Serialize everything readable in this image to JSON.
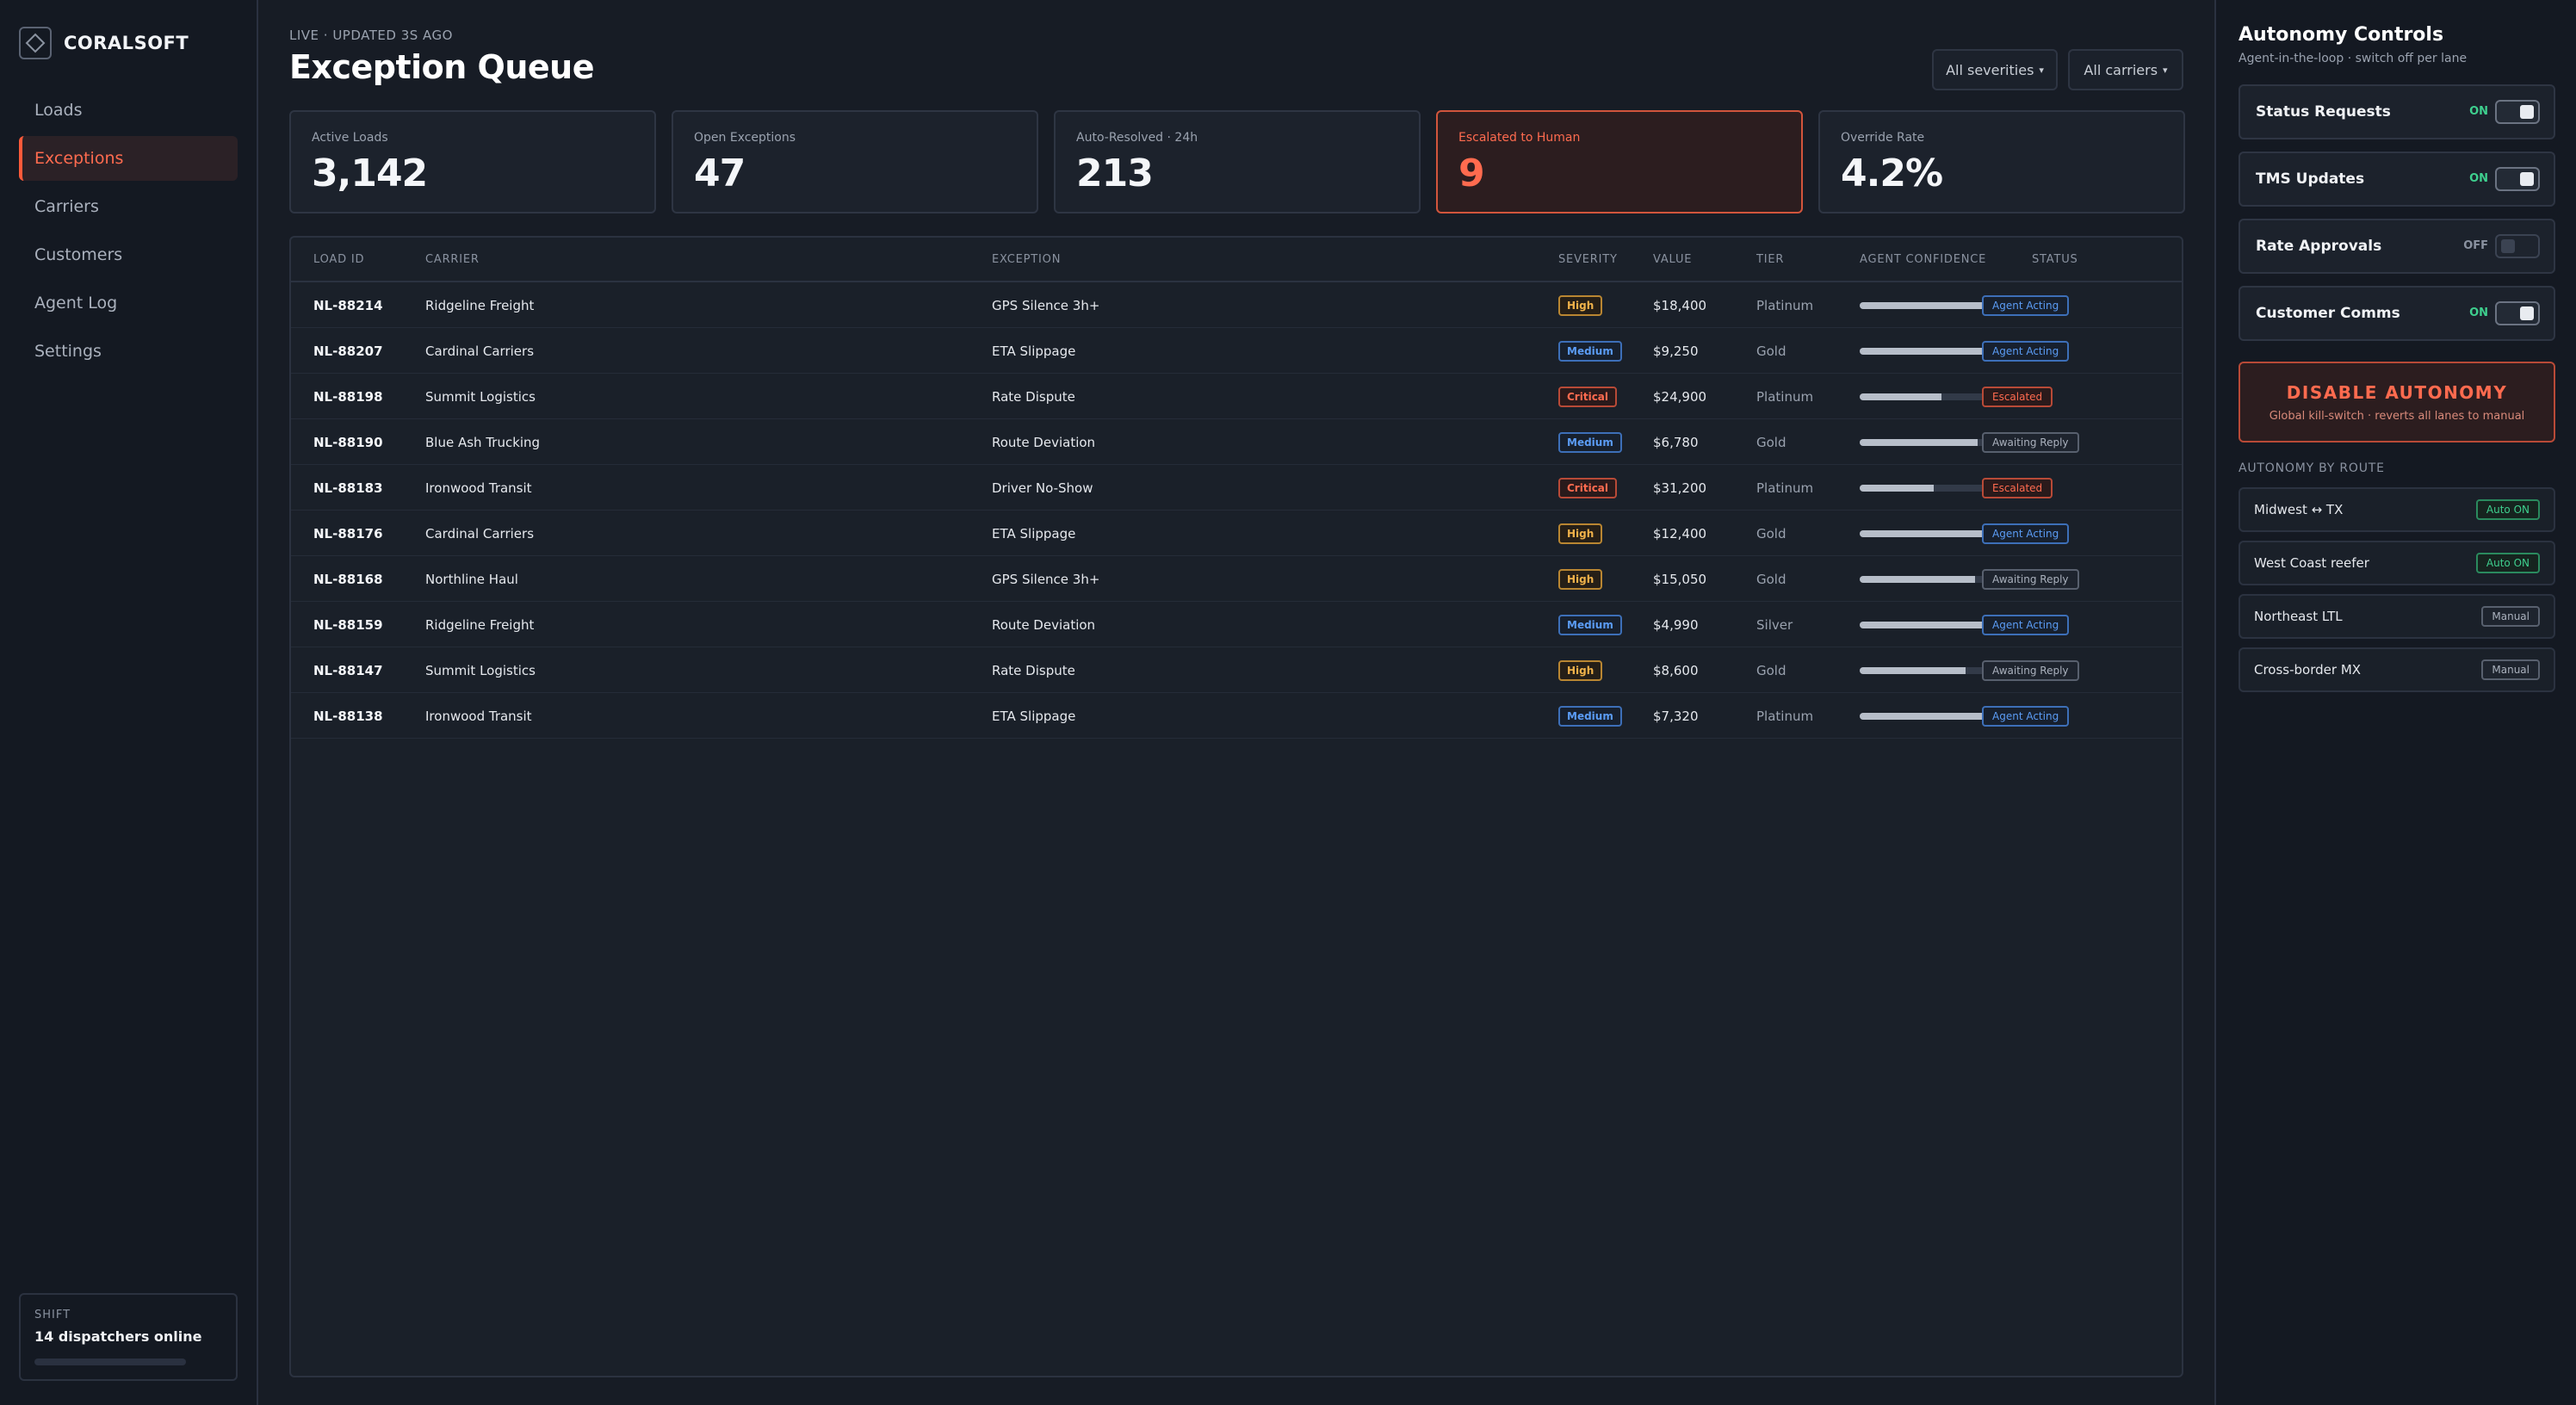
{
  "brand": {
    "name": "CORALSOFT"
  },
  "nav": [
    {
      "label": "Loads",
      "active": false
    },
    {
      "label": "Exceptions",
      "active": true
    },
    {
      "label": "Carriers",
      "active": false
    },
    {
      "label": "Customers",
      "active": false
    },
    {
      "label": "Agent Log",
      "active": false
    },
    {
      "label": "Settings",
      "active": false
    }
  ],
  "shift": {
    "label": "SHIFT",
    "text": "14 dispatchers online",
    "progress": 0.0
  },
  "header": {
    "live": "LIVE · UPDATED 3S AGO",
    "title": "Exception Queue",
    "filter_severity": "All severities",
    "filter_carrier": "All carriers"
  },
  "kpis": [
    {
      "label": "Active Loads",
      "value": "3,142",
      "alert": false
    },
    {
      "label": "Open Exceptions",
      "value": "47",
      "alert": false
    },
    {
      "label": "Auto-Resolved · 24h",
      "value": "213",
      "alert": false
    },
    {
      "label": "Escalated to Human",
      "value": "9",
      "alert": true
    },
    {
      "label": "Override Rate",
      "value": "4.2%",
      "alert": false
    }
  ],
  "table": {
    "headers": {
      "load_id": "LOAD ID",
      "carrier": "CARRIER",
      "exception": "EXCEPTION",
      "severity": "SEVERITY",
      "value": "VALUE",
      "tier": "TIER",
      "confidence": "AGENT CONFIDENCE",
      "status": "STATUS"
    },
    "rows": [
      {
        "id": "NL-88214",
        "carrier": "Ridgeline Freight",
        "exception": "GPS Silence 3h+",
        "severity": "High",
        "value": "$18,400",
        "tier": "Platinum",
        "confidence": "0.91",
        "status": "Agent Acting"
      },
      {
        "id": "NL-88207",
        "carrier": "Cardinal Carriers",
        "exception": "ETA Slippage",
        "severity": "Medium",
        "value": "$9,250",
        "tier": "Gold",
        "confidence": "0.94",
        "status": "Agent Acting"
      },
      {
        "id": "NL-88198",
        "carrier": "Summit Logistics",
        "exception": "Rate Dispute",
        "severity": "Critical",
        "value": "$24,900",
        "tier": "Platinum",
        "confidence": "0.61",
        "status": "Escalated"
      },
      {
        "id": "NL-88190",
        "carrier": "Blue Ash Trucking",
        "exception": "Route Deviation",
        "severity": "Medium",
        "value": "$6,780",
        "tier": "Gold",
        "confidence": "0.88",
        "status": "Awaiting Reply"
      },
      {
        "id": "NL-88183",
        "carrier": "Ironwood Transit",
        "exception": "Driver No-Show",
        "severity": "Critical",
        "value": "$31,200",
        "tier": "Platinum",
        "confidence": "0.55",
        "status": "Escalated"
      },
      {
        "id": "NL-88176",
        "carrier": "Cardinal Carriers",
        "exception": "ETA Slippage",
        "severity": "High",
        "value": "$12,400",
        "tier": "Gold",
        "confidence": "0.92",
        "status": "Agent Acting"
      },
      {
        "id": "NL-88168",
        "carrier": "Northline Haul",
        "exception": "GPS Silence 3h+",
        "severity": "High",
        "value": "$15,050",
        "tier": "Gold",
        "confidence": "0.86",
        "status": "Awaiting Reply"
      },
      {
        "id": "NL-88159",
        "carrier": "Ridgeline Freight",
        "exception": "Route Deviation",
        "severity": "Medium",
        "value": "$4,990",
        "tier": "Silver",
        "confidence": "0.95",
        "status": "Agent Acting"
      },
      {
        "id": "NL-88147",
        "carrier": "Summit Logistics",
        "exception": "Rate Dispute",
        "severity": "High",
        "value": "$8,600",
        "tier": "Gold",
        "confidence": "0.79",
        "status": "Awaiting Reply"
      },
      {
        "id": "NL-88138",
        "carrier": "Ironwood Transit",
        "exception": "ETA Slippage",
        "severity": "Medium",
        "value": "$7,320",
        "tier": "Platinum",
        "confidence": "0.93",
        "status": "Agent Acting"
      }
    ]
  },
  "autonomy": {
    "title": "Autonomy Controls",
    "subtitle": "Agent-in-the-loop · switch off per lane",
    "controls": [
      {
        "label": "Status Requests",
        "state": "ON",
        "on": true
      },
      {
        "label": "TMS Updates",
        "state": "ON",
        "on": true
      },
      {
        "label": "Rate Approvals",
        "state": "OFF",
        "on": false
      },
      {
        "label": "Customer Comms",
        "state": "ON",
        "on": true
      }
    ],
    "kill_switch": {
      "title": "DISABLE AUTONOMY",
      "subtitle": "Global kill-switch · reverts all lanes to manual"
    },
    "route_heading": "AUTONOMY BY ROUTE",
    "routes": [
      {
        "name": "Midwest ↔ TX",
        "badge": "Auto ON",
        "auto": true
      },
      {
        "name": "West Coast reefer",
        "badge": "Auto ON",
        "auto": true
      },
      {
        "name": "Northeast LTL",
        "badge": "Manual",
        "auto": false
      },
      {
        "name": "Cross-border MX",
        "badge": "Manual",
        "auto": false
      }
    ]
  },
  "colors": {
    "accent": "#ff5a3a",
    "on": "#3ecf8e",
    "info": "#5b9cf5",
    "warning": "#f0b24a"
  }
}
